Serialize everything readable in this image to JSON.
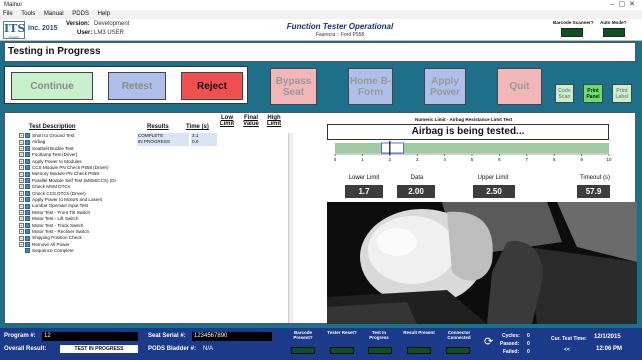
{
  "window": {
    "title": "Mainui"
  },
  "menu": [
    "File",
    "Tools",
    "Manual",
    "PDDS",
    "Help"
  ],
  "header": {
    "logo": "ITS",
    "logo_sub": "Infotech",
    "company": "Inc. 2015",
    "version_label": "Version:",
    "version_value": "Development",
    "user_label": "User:",
    "user_value": "LM3 USER",
    "tester_title": "Function Tester Operational",
    "tester_subtitle": "Faurecia :: Ford P558",
    "barcode_label": "Barcode Scanner?",
    "automode_label": "Auto Mode?"
  },
  "status": {
    "text": "Testing in Progress"
  },
  "buttons": {
    "continue": "Continue",
    "retest": "Retest",
    "reject": "Reject",
    "bypass_seat": "Bypass Seat",
    "home_bform": "Home B-Form",
    "apply_power": "Apply Power",
    "quit": "Quit",
    "code_scan": "Code Scan",
    "print_panel": "Print Panel",
    "print_label": "Print Label"
  },
  "table": {
    "headers": {
      "test_description": "Test Description",
      "results": "Results",
      "time": "Time (s)",
      "low_limit": "Low Limit",
      "final_value": "Final Value",
      "high_limit": "High Limit"
    },
    "rows": [
      {
        "name": "Short to Ground Test",
        "result": "COMPLETE",
        "time": "3.1"
      },
      {
        "name": "Airbag",
        "result": "IN PROGRESS",
        "time": "0.0"
      },
      {
        "name": "Seatbelt Buckle Test",
        "result": "",
        "time": ""
      },
      {
        "name": "Footlamp Test (Driver)",
        "result": "",
        "time": ""
      },
      {
        "name": "Apply Power to Modules",
        "result": "",
        "time": ""
      },
      {
        "name": "CCS Module PN Check P558 (Driver)",
        "result": "",
        "time": ""
      },
      {
        "name": "Memory Module PN Check P558",
        "result": "",
        "time": ""
      },
      {
        "name": "Parallel Module Self Test (MSM/CCS) (Dr",
        "result": "",
        "time": ""
      },
      {
        "name": "Check MSM DTCs",
        "result": "",
        "time": ""
      },
      {
        "name": "Check CCS DTCs (Driver)",
        "result": "",
        "time": ""
      },
      {
        "name": "Apply Power to Motors and Lasers",
        "result": "",
        "time": ""
      },
      {
        "name": "Lumbar Operator Input Test",
        "result": "",
        "time": ""
      },
      {
        "name": "Motor Test - Front Tilt Switch",
        "result": "",
        "time": ""
      },
      {
        "name": "Motor Test - Lift Switch",
        "result": "",
        "time": ""
      },
      {
        "name": "Motor Test - Track Switch",
        "result": "",
        "time": ""
      },
      {
        "name": "Motor Test - Recliner Switch",
        "result": "",
        "time": ""
      },
      {
        "name": "Shipping Position Check",
        "result": "",
        "time": ""
      },
      {
        "name": "Remove All Power",
        "result": "",
        "time": ""
      },
      {
        "name": "Sequence Complete",
        "result": "",
        "time": ""
      }
    ]
  },
  "gauge": {
    "title": "Numeric Limit - Airbag Resistance Limit Test",
    "message": "Airbag is being tested...",
    "scale_min": 0,
    "scale_max": 10,
    "ticks": [
      "0",
      "1",
      "2",
      "3",
      "4",
      "5",
      "6",
      "7",
      "8",
      "9",
      "10"
    ],
    "lower_limit_label": "Lower Limit",
    "data_label": "Data",
    "upper_limit_label": "Upper Limit",
    "timeout_label": "Timeout (s)",
    "lower_limit": "1.7",
    "data": "2.00",
    "upper_limit": "2.50",
    "timeout": "57.9",
    "lower_limit_value": 1.7,
    "data_value": 2.0,
    "upper_limit_value": 2.5
  },
  "bottom": {
    "program_label": "Program #:",
    "program_value": "12",
    "seat_serial_label": "Seat Serial #:",
    "seat_serial_value": "1234567890",
    "overall_label": "Overall Result:",
    "overall_value": "TEST IN PROGRESS",
    "pods_label": "PODS Bladder #:",
    "pods_value": "N/A",
    "indicators": [
      "Barcode Present?",
      "Tester Reset?",
      "Test In Progress",
      "Result Present",
      "Connector Connected"
    ],
    "cycles_label": "Cycles:",
    "passed_label": "Passed:",
    "failed_label": "Failed:",
    "cycles": "0",
    "passed": "0",
    "failed": "0",
    "cur_test_time_label": "Cur. Test Time:",
    "cur_test_time": "<<",
    "date": "12/1/2015",
    "time": "12:06 PM"
  },
  "colors": {
    "continue_bg": "#c8f0cc",
    "retest_bg": "#aebfe9",
    "reject_bg": "#f05050",
    "bypass_bg": "#f2b6b9",
    "home_bg": "#aebfe9",
    "apply_bg": "#aebfe9",
    "quit_bg": "#f2b6b9",
    "code_bg": "#c8f0cc",
    "print_panel_bg": "#69e06a",
    "print_label_bg": "#c8f0cc",
    "bar_green": "#9fcba3",
    "led_green": "#114e22",
    "bottom_bg": "#1b3a8a"
  }
}
